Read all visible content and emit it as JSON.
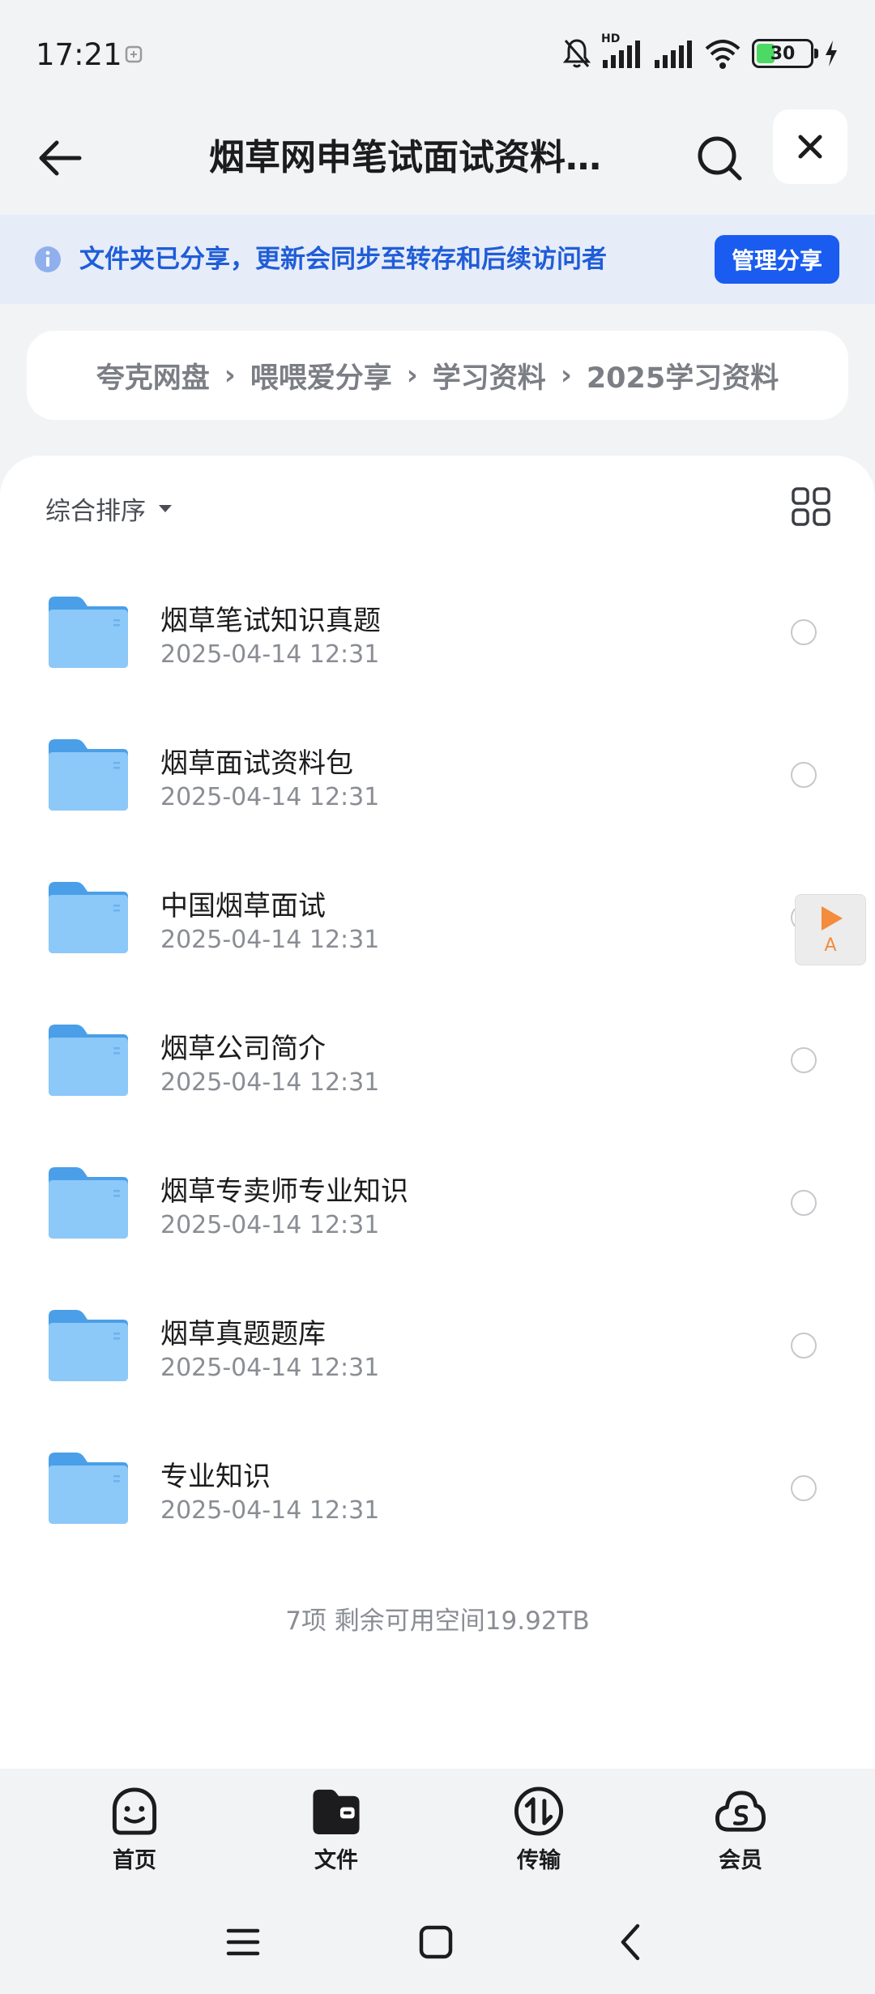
{
  "status_bar": {
    "time": "17:21",
    "network_label": "HD",
    "battery_level": "30"
  },
  "header": {
    "title": "烟草网申笔试面试资料…"
  },
  "share_banner": {
    "text": "文件夹已分享，更新会同步至转存和后续访问者",
    "manage_button": "管理分享"
  },
  "breadcrumb": [
    "夸克网盘",
    "喂喂爱分享",
    "学习资料",
    "2025学习资料"
  ],
  "breadcrumb_separator": "›",
  "sort": {
    "label": "综合排序"
  },
  "files": [
    {
      "name": "烟草笔试知识真题",
      "date": "2025-04-14 12:31"
    },
    {
      "name": "烟草面试资料包",
      "date": "2025-04-14 12:31"
    },
    {
      "name": "中国烟草面试",
      "date": "2025-04-14 12:31"
    },
    {
      "name": "烟草公司简介",
      "date": "2025-04-14 12:31"
    },
    {
      "name": "烟草专卖师专业知识",
      "date": "2025-04-14 12:31"
    },
    {
      "name": "烟草真题题库",
      "date": "2025-04-14 12:31"
    },
    {
      "name": "专业知识",
      "date": "2025-04-14 12:31"
    }
  ],
  "summary": "7项 剩余可用空间19.92TB",
  "floating_widget": {
    "letter": "A"
  },
  "tabs": [
    {
      "label": "首页",
      "icon": "home-face-icon"
    },
    {
      "label": "文件",
      "icon": "folder-icon",
      "active": true
    },
    {
      "label": "传输",
      "icon": "transfer-icon"
    },
    {
      "label": "会员",
      "icon": "member-cloud-icon"
    }
  ],
  "colors": {
    "accent": "#1a5cf0",
    "banner_bg": "#e6ecf8",
    "banner_text": "#1f5dd8",
    "folder": "#64b3f4",
    "page_bg": "#f2f3f5"
  }
}
